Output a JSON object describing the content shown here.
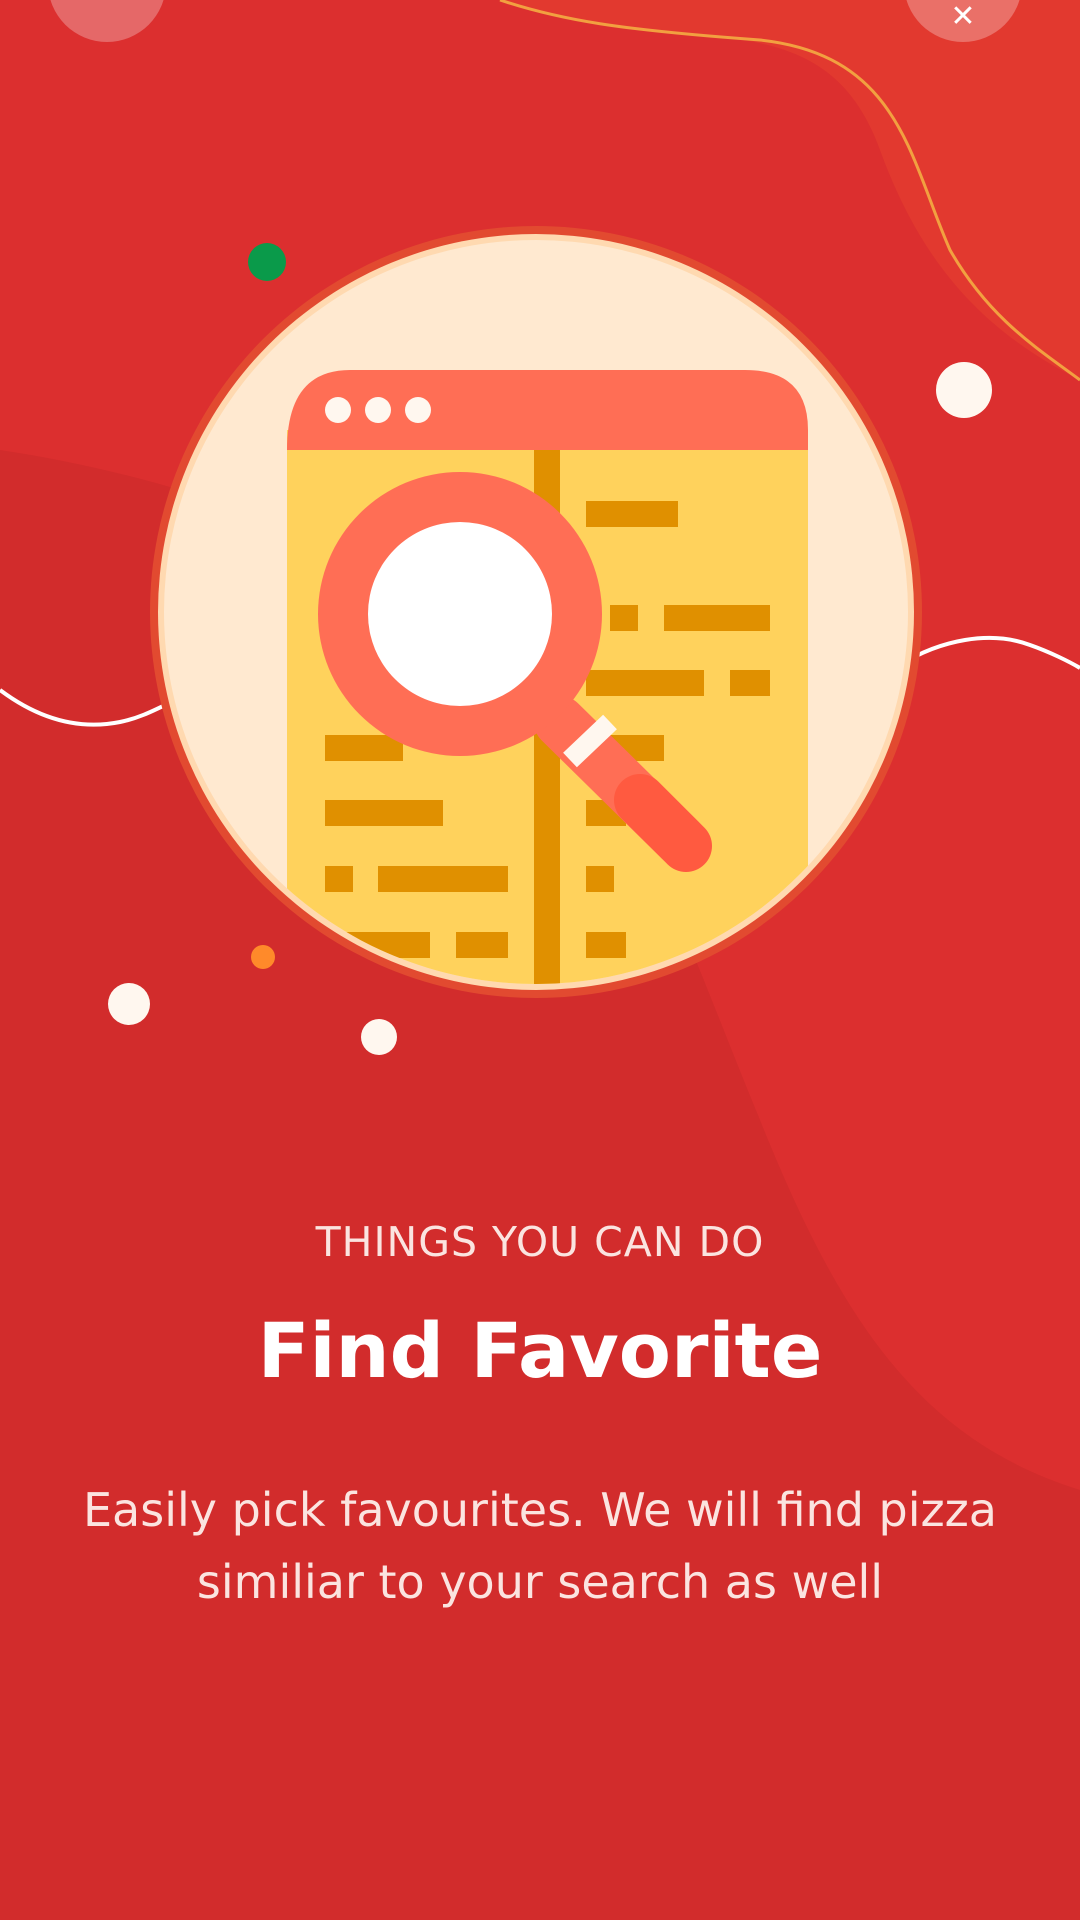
{
  "onboarding": {
    "eyebrow": "THINGS YOU CAN DO",
    "title": "Find Favorite",
    "description_lines": [
      "Easily pick favourites. We will find pizza",
      "similiar to your search as well"
    ]
  },
  "top_bar": {
    "left_button_icon": "back-icon",
    "right_button_icon": "close-icon",
    "right_button_glyph": "✕"
  },
  "illustration": {
    "icon": "search-browser-illustration"
  },
  "colors": {
    "background": "#DC2F2F",
    "background_shade": "#D02C2C",
    "circle_fill": "#FFE9D0",
    "window_header": "#FF6E55",
    "window_body": "#FFD25C",
    "text_lines": "#E09000",
    "magnifier": "#FF6E55",
    "accent_green": "#0A9A4A",
    "accent_orange": "#FF8A2A",
    "wave_line_top": "#F2A040",
    "wave_line_white": "#FFFFFF"
  }
}
